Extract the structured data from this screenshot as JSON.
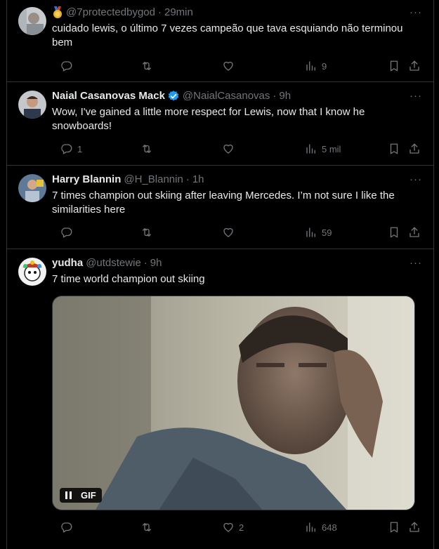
{
  "tweets": [
    {
      "name": "",
      "badge_icon": "medal-icon",
      "handle": "@7protectedbygod",
      "sep": "·",
      "time": "29min",
      "text": "cuidado lewis, o último 7 vezes campeão que tava esquiando não terminou bem",
      "replies": "",
      "retweets": "",
      "likes": "",
      "views": "9"
    },
    {
      "name": "Naial Casanovas Mack",
      "verified": true,
      "handle": "@NaialCasanovas",
      "sep": "·",
      "time": "9h",
      "text": "Wow, I've gained a little more respect for Lewis, now that I know he snowboards!",
      "replies": "1",
      "retweets": "",
      "likes": "",
      "views": "5 mil"
    },
    {
      "name": "Harry Blannin",
      "handle": "@H_Blannin",
      "sep": "·",
      "time": "1h",
      "text": "7 times champion out skiing after leaving Mercedes. I’m not sure I like the similarities here",
      "replies": "",
      "retweets": "",
      "likes": "",
      "views": "59"
    },
    {
      "name": "yudha",
      "handle": "@utdstewie",
      "sep": "·",
      "time": "9h",
      "text": "7 time world champion out skiing",
      "media_badge": "GIF",
      "replies": "",
      "retweets": "",
      "likes": "2",
      "views": "648"
    }
  ],
  "more_label": "···",
  "colors": {
    "background": "#000000",
    "text": "#e7e9ea",
    "muted": "#71767b",
    "border": "#2f3336",
    "verified": "#1d9bf0"
  }
}
